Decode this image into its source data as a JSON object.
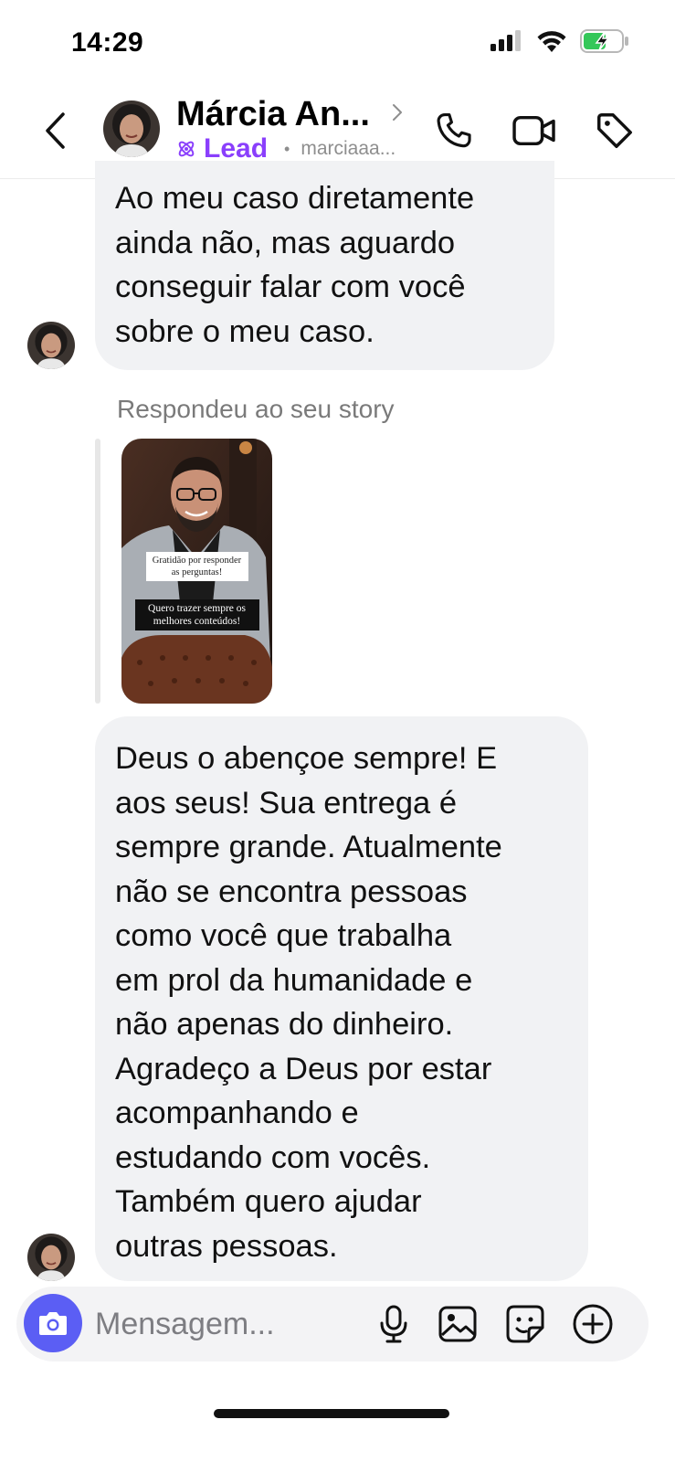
{
  "status_bar": {
    "time": "14:29"
  },
  "header": {
    "contact_name": "Márcia An...",
    "lead_label": "Lead",
    "separator": "•",
    "username": "marciaaa..."
  },
  "messages": [
    {
      "id": "msg1",
      "sender": "contact",
      "text": "Ao meu caso diretamente\nainda não, mas aguardo\nconseguir falar com você\nsobre o meu caso."
    },
    {
      "id": "story_reply",
      "label": "Respondeu ao seu story",
      "story_caption_1": "Gratidão por responder as perguntas!",
      "story_caption_2": "Quero trazer sempre os melhores conteúdos!"
    },
    {
      "id": "msg2",
      "sender": "contact",
      "text": "Deus o abençoe sempre! E\naos seus! Sua entrega é\nsempre grande. Atualmente\nnão se encontra pessoas\ncomo você que trabalha\nem prol da humanidade e\nnão apenas do dinheiro.\nAgradeço a Deus por estar\nacompanhando e\nestudando com vocês.\nTambém quero ajudar\noutras pessoas."
    }
  ],
  "composer": {
    "placeholder": "Mensagem...",
    "value": ""
  },
  "colors": {
    "accent_purple": "#8a3ffc",
    "camera_button": "#5b5ef4",
    "bubble": "#f1f2f4",
    "battery_green": "#34c759"
  },
  "icons": {
    "back": "chevron-left-icon",
    "phone": "phone-icon",
    "video": "video-camera-icon",
    "tag": "tag-icon",
    "mic": "microphone-icon",
    "gallery": "image-icon",
    "sticker": "sticker-icon",
    "add": "plus-circle-icon",
    "camera": "camera-icon"
  }
}
